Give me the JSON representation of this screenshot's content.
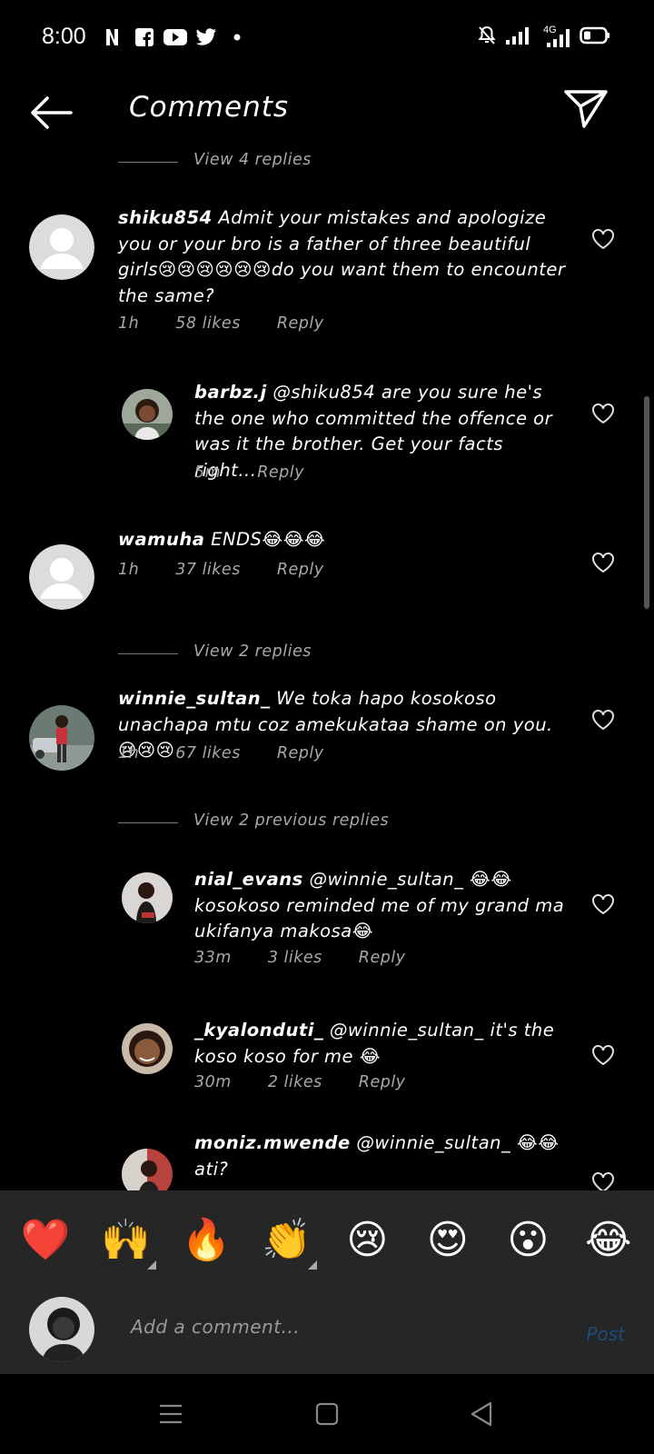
{
  "status_bar": {
    "time": "8:00",
    "app_icons": [
      "netflix-icon",
      "facebook-icon",
      "youtube-icon",
      "twitter-icon",
      "dot-icon"
    ],
    "network": "4G"
  },
  "header": {
    "title": "Comments"
  },
  "feed": {
    "top_view": "View 4 replies",
    "c1": {
      "user": "shiku854",
      "text": " Admit your mistakes and apologize you or your bro is a father of three beautiful girls😢😢😢😢😢😢do you want them to encounter the same?",
      "time": "1h",
      "likes": "58 likes",
      "reply": "Reply"
    },
    "r1": {
      "user": "barbz.j",
      "text": " @shiku854 are you sure he's the one who committed the offence or was it the brother. Get your facts right...",
      "time": "5m",
      "reply": "Reply"
    },
    "c2": {
      "user": "wamuha",
      "text": " ENDS😂😂😂",
      "time": "1h",
      "likes": "37 likes",
      "reply": "Reply"
    },
    "view2": "View 2 replies",
    "c3": {
      "user": "winnie_sultan_",
      "text": " We toka hapo kosokoso unachapa mtu coz amekukataa shame on you.😢😢😢",
      "time": "1h",
      "likes": "67 likes",
      "reply": "Reply"
    },
    "view_prev": "View 2 previous replies",
    "r2": {
      "user": "nial_evans",
      "text": " @winnie_sultan_ 😂😂kosokoso reminded me of my grand ma ukifanya makosa😂",
      "time": "33m",
      "likes": "3 likes",
      "reply": "Reply"
    },
    "r3": {
      "user": "_kyalonduti_",
      "text": " @winnie_sultan_ it's the koso koso for me 😂",
      "time": "30m",
      "likes": "2 likes",
      "reply": "Reply"
    },
    "r4": {
      "user": "moniz.mwende",
      "text": " @winnie_sultan_ 😂😂 ati?"
    }
  },
  "reactions": [
    "❤️",
    "🙌",
    "🔥",
    "👏",
    "😢",
    "😍",
    "😮",
    "😂"
  ],
  "composer": {
    "placeholder": "Add a comment...",
    "post_label": "Post"
  },
  "colors": {
    "background": "#000000",
    "panel": "#262626",
    "post_disabled": "#1c4c7a",
    "muted": "#a8a8a8"
  }
}
